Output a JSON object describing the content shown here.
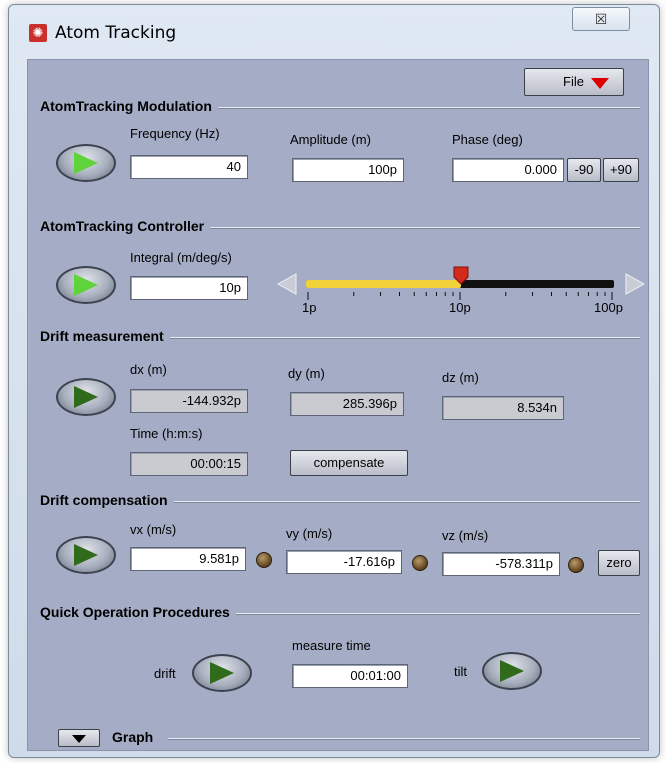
{
  "window": {
    "title": "Atom Tracking",
    "close_label": "☒"
  },
  "file_menu": {
    "label": "File"
  },
  "modulation": {
    "title": "AtomTracking Modulation",
    "frequency": {
      "label": "Frequency (Hz)",
      "value": "40"
    },
    "amplitude": {
      "label": "Amplitude (m)",
      "value": "100p"
    },
    "phase": {
      "label": "Phase (deg)",
      "value": "0.000",
      "minus_label": "-90",
      "plus_label": "+90"
    }
  },
  "controller": {
    "title": "AtomTracking Controller",
    "integral": {
      "label": "Integral (m/deg/s)",
      "value": "10p"
    },
    "slider": {
      "tick_labels": [
        "1p",
        "10p",
        "100p"
      ],
      "value": "10p",
      "fill_color": "#f2d23a",
      "thumb_color": "#d42a1a"
    }
  },
  "drift_measurement": {
    "title": "Drift measurement",
    "dx": {
      "label": "dx (m)",
      "value": "-144.932p"
    },
    "dy": {
      "label": "dy (m)",
      "value": "285.396p"
    },
    "dz": {
      "label": "dz (m)",
      "value": "8.534n"
    },
    "time": {
      "label": "Time (h:m:s)",
      "value": "00:00:15"
    },
    "compensate_label": "compensate"
  },
  "drift_compensation": {
    "title": "Drift compensation",
    "vx": {
      "label": "vx (m/s)",
      "value": "9.581p"
    },
    "vy": {
      "label": "vy (m/s)",
      "value": "-17.616p"
    },
    "vz": {
      "label": "vz (m/s)",
      "value": "-578.311p"
    },
    "zero_label": "zero"
  },
  "quick_ops": {
    "title": "Quick Operation Procedures",
    "drift_label": "drift",
    "measure_time": {
      "label": "measure time",
      "value": "00:01:00"
    },
    "tilt_label": "tilt"
  },
  "graph": {
    "label": "Graph"
  },
  "colors": {
    "accent_arrow": "#e00000",
    "panel_bg": "#a5adc6"
  }
}
